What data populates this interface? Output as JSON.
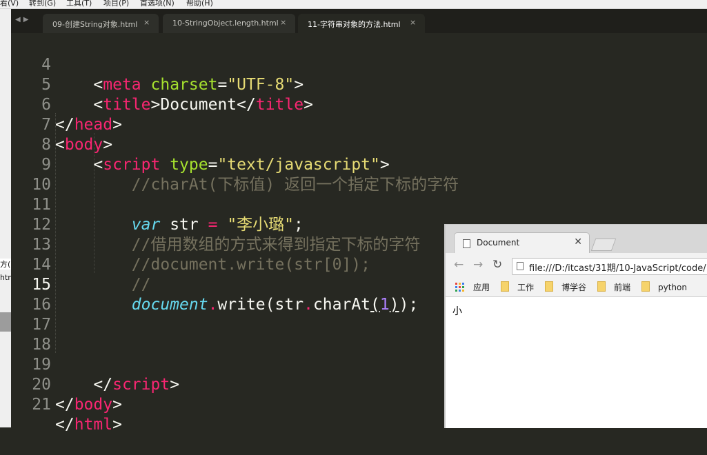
{
  "menubar": {
    "items": [
      "看(V)",
      "转到(G)",
      "工具(T)",
      "项目(P)",
      "首选项(N)",
      "帮助(H)"
    ]
  },
  "left_strip": {
    "frag1": "方()",
    "frag2": "htm"
  },
  "tabs": [
    {
      "label": "09-创建String对象.html",
      "active": false
    },
    {
      "label": "10-StringObject.length.html",
      "active": false
    },
    {
      "label": "11-字符串对象的方法.html",
      "active": true
    }
  ],
  "tab_close_glyph": "×",
  "code": {
    "line_numbers": [
      "4",
      "5",
      "6",
      "7",
      "8",
      "9",
      "10",
      "11",
      "12",
      "13",
      "14",
      "15",
      "16",
      "17",
      "18",
      "19",
      "20",
      "21"
    ],
    "current_line": "15",
    "meta_tag": "meta",
    "meta_attr": "charset",
    "meta_val": "\"UTF-8\"",
    "title_tag": "title",
    "title_text": "Document",
    "head_tag": "head",
    "body_tag": "body",
    "script_tag": "script",
    "script_attr": "type",
    "script_val": "\"text/javascript\"",
    "comment1": "//charAt(下标值) 返回一个指定下标的字符",
    "var_kw": "var",
    "var_name": "str",
    "var_val": "\"李小璐\"",
    "comment2": "//借用数组的方式来得到指定下标的字符",
    "comment3": "//document.write(str[0]);",
    "comment4": "//",
    "doc_obj": "document",
    "write_fn": "write",
    "str_ref": "str",
    "charat_fn": "charAt",
    "index_arg": "1",
    "html_tag": "html"
  },
  "browser": {
    "tab_title": "Document",
    "url": "file:///D:/itcast/31期/10-JavaScript/code/",
    "bookmarks": [
      "应用",
      "工作",
      "博学谷",
      "前端",
      "python"
    ],
    "page_text": "小"
  }
}
